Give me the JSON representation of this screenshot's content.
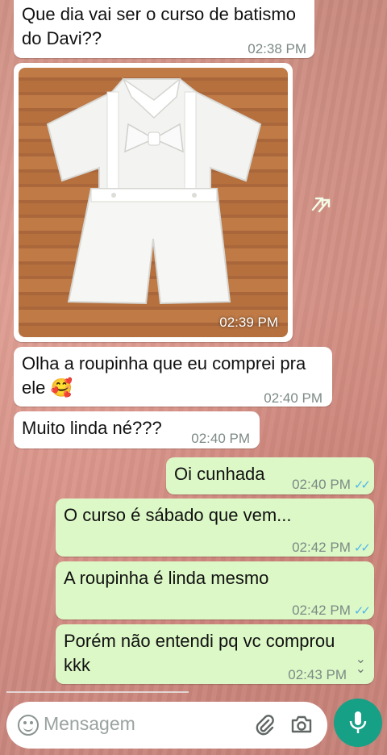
{
  "messages": {
    "m1": {
      "text": "Que dia vai ser o curso de batismo\ndo Davi??",
      "time": "02:38 PM"
    },
    "image": {
      "time": "02:39 PM"
    },
    "m2": {
      "text": "Olha a roupinha que eu comprei pra\nele 🥰",
      "time": "02:40 PM"
    },
    "m3": {
      "text": "Muito linda né???",
      "time": "02:40 PM"
    },
    "m4": {
      "text": "Oi cunhada",
      "time": "02:40 PM"
    },
    "m5": {
      "text": "O curso é sábado que vem...",
      "time": "02:42 PM"
    },
    "m6": {
      "text": "A roupinha é linda mesmo",
      "time": "02:42 PM"
    },
    "m7": {
      "text": "Porém não entendi pq vc comprou\nkkk",
      "time": "02:43 PM"
    }
  },
  "composer": {
    "placeholder": "Mensagem"
  },
  "icons": {
    "forward": "forward-icon",
    "emoji": "emoji-icon",
    "attach": "paperclip-icon",
    "camera": "camera-icon",
    "mic": "microphone-icon",
    "scroll_down": "chevron-down-icon",
    "read_receipt": "double-check-icon"
  },
  "colors": {
    "incoming": "#ffffff",
    "outgoing": "#dcf8c6",
    "accent": "#16a085",
    "read_tick": "#4fb6ec"
  }
}
